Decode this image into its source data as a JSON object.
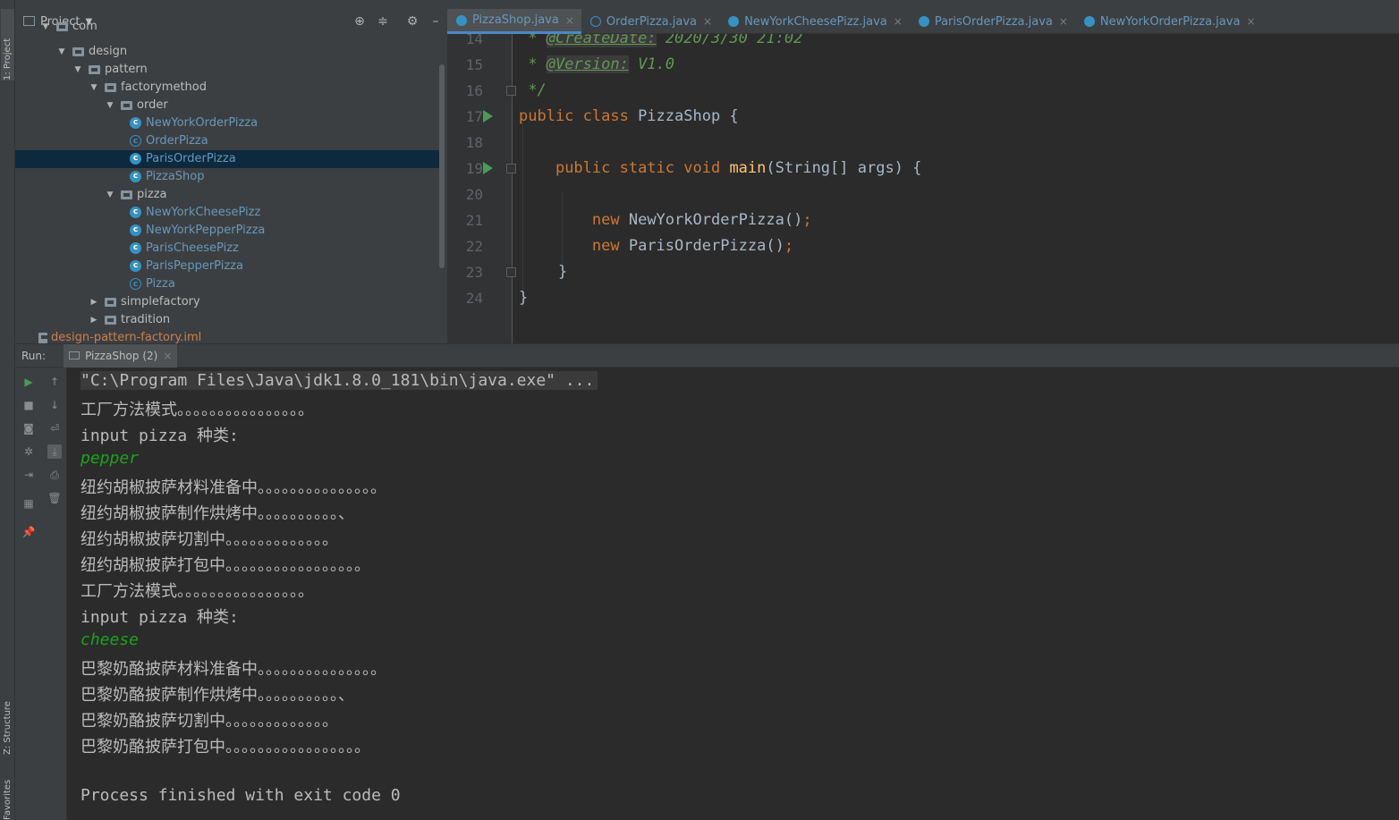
{
  "left_strip": {
    "project_tab": "1: Project",
    "structure_tab": "Z: Structure",
    "favorites_tab": "Favorites"
  },
  "project_panel": {
    "title": "Project",
    "tree": [
      {
        "label": "com",
        "kind": "folder",
        "depth": 3,
        "expanded": true
      },
      {
        "label": "design",
        "kind": "folder",
        "depth": 4,
        "expanded": true
      },
      {
        "label": "pattern",
        "kind": "folder",
        "depth": 5,
        "expanded": true
      },
      {
        "label": "factorymethod",
        "kind": "folder",
        "depth": 6,
        "expanded": true
      },
      {
        "label": "order",
        "kind": "folder",
        "depth": 7,
        "expanded": true
      },
      {
        "label": "NewYorkOrderPizza",
        "kind": "class",
        "depth": 8
      },
      {
        "label": "OrderPizza",
        "kind": "abstract",
        "depth": 8
      },
      {
        "label": "ParisOrderPizza",
        "kind": "class",
        "depth": 8,
        "selected": true
      },
      {
        "label": "PizzaShop",
        "kind": "class",
        "depth": 8
      },
      {
        "label": "pizza",
        "kind": "folder",
        "depth": 7,
        "expanded": true
      },
      {
        "label": "NewYorkCheesePizz",
        "kind": "class",
        "depth": 8
      },
      {
        "label": "NewYorkPepperPizza",
        "kind": "class",
        "depth": 8
      },
      {
        "label": "ParisCheesePizz",
        "kind": "class",
        "depth": 8
      },
      {
        "label": "ParisPepperPizza",
        "kind": "class",
        "depth": 8
      },
      {
        "label": "Pizza",
        "kind": "abstract",
        "depth": 8
      },
      {
        "label": "simplefactory",
        "kind": "folder",
        "depth": 6,
        "expanded": false
      },
      {
        "label": "tradition",
        "kind": "folder",
        "depth": 6,
        "expanded": false
      },
      {
        "label": "design-pattern-factory.iml",
        "kind": "file",
        "depth": 2
      }
    ]
  },
  "editor_tabs": [
    {
      "label": "PizzaShop.java",
      "active": true,
      "icon": "class"
    },
    {
      "label": "OrderPizza.java",
      "active": false,
      "icon": "abstract"
    },
    {
      "label": "NewYorkCheesePizz.java",
      "active": false,
      "icon": "class"
    },
    {
      "label": "ParisOrderPizza.java",
      "active": false,
      "icon": "class"
    },
    {
      "label": "NewYorkOrderPizza.java",
      "active": false,
      "icon": "class"
    }
  ],
  "editor": {
    "line_numbers": [
      "14",
      "15",
      "16",
      "17",
      "18",
      "19",
      "20",
      "21",
      "22",
      "23",
      "24"
    ],
    "lines": {
      "l14_prefix": " * ",
      "l14_tag": "@CreateDate:",
      "l14_value": " 2020/3/30 21:02",
      "l15_prefix": " * ",
      "l15_tag": "@Version:",
      "l15_value": " V1.0",
      "l16": " */",
      "l17_kw": "public class",
      "l17_rest": " PizzaShop {",
      "l19_kw": "public static void",
      "l19_fn": "main",
      "l19_rest": "(String[] args) {",
      "l21_kw": "new",
      "l21_rest": " NewYorkOrderPizza()",
      "l21_semi": ";",
      "l22_kw": "new",
      "l22_rest": " ParisOrderPizza()",
      "l22_semi": ";",
      "l23": "}",
      "l24": "}"
    }
  },
  "run_panel": {
    "title": "Run:",
    "tab_label": "PizzaShop (2)",
    "console": {
      "cmd": "\"C:\\Program Files\\Java\\jdk1.8.0_181\\bin\\java.exe\" ...",
      "l1": "工厂方法模式。。。。。。。。。。。。。。。。",
      "l2": "input pizza 种类:",
      "l3": "pepper",
      "l4": "纽约胡椒披萨材料准备中。。。。。。。。。。。。。。。",
      "l5": "纽约胡椒披萨制作烘烤中。。。。。。。。。。、",
      "l6": "纽约胡椒披萨切割中。。。。。。。。。。。。。",
      "l7": "纽约胡椒披萨打包中。。。。。。。。。。。。。。。。。",
      "l8": "工厂方法模式。。。。。。。。。。。。。。。。",
      "l9": "input pizza 种类:",
      "l10": "cheese",
      "l11": "巴黎奶酪披萨材料准备中。。。。。。。。。。。。。。。",
      "l12": "巴黎奶酪披萨制作烘烤中。。。。。。。。。。、",
      "l13": "巴黎奶酪披萨切割中。。。。。。。。。。。。。",
      "l14": "巴黎奶酪披萨打包中。。。。。。。。。。。。。。。。。",
      "exit": "Process finished with exit code 0"
    }
  },
  "colors": {
    "background": "#2b2b2b",
    "panel": "#3c3f41",
    "keyword": "#cc7832",
    "comment": "#629755",
    "function": "#ffc66d",
    "class_blue": "#6897bb",
    "selection": "#0d293e",
    "input_green": "#1aa31a"
  }
}
